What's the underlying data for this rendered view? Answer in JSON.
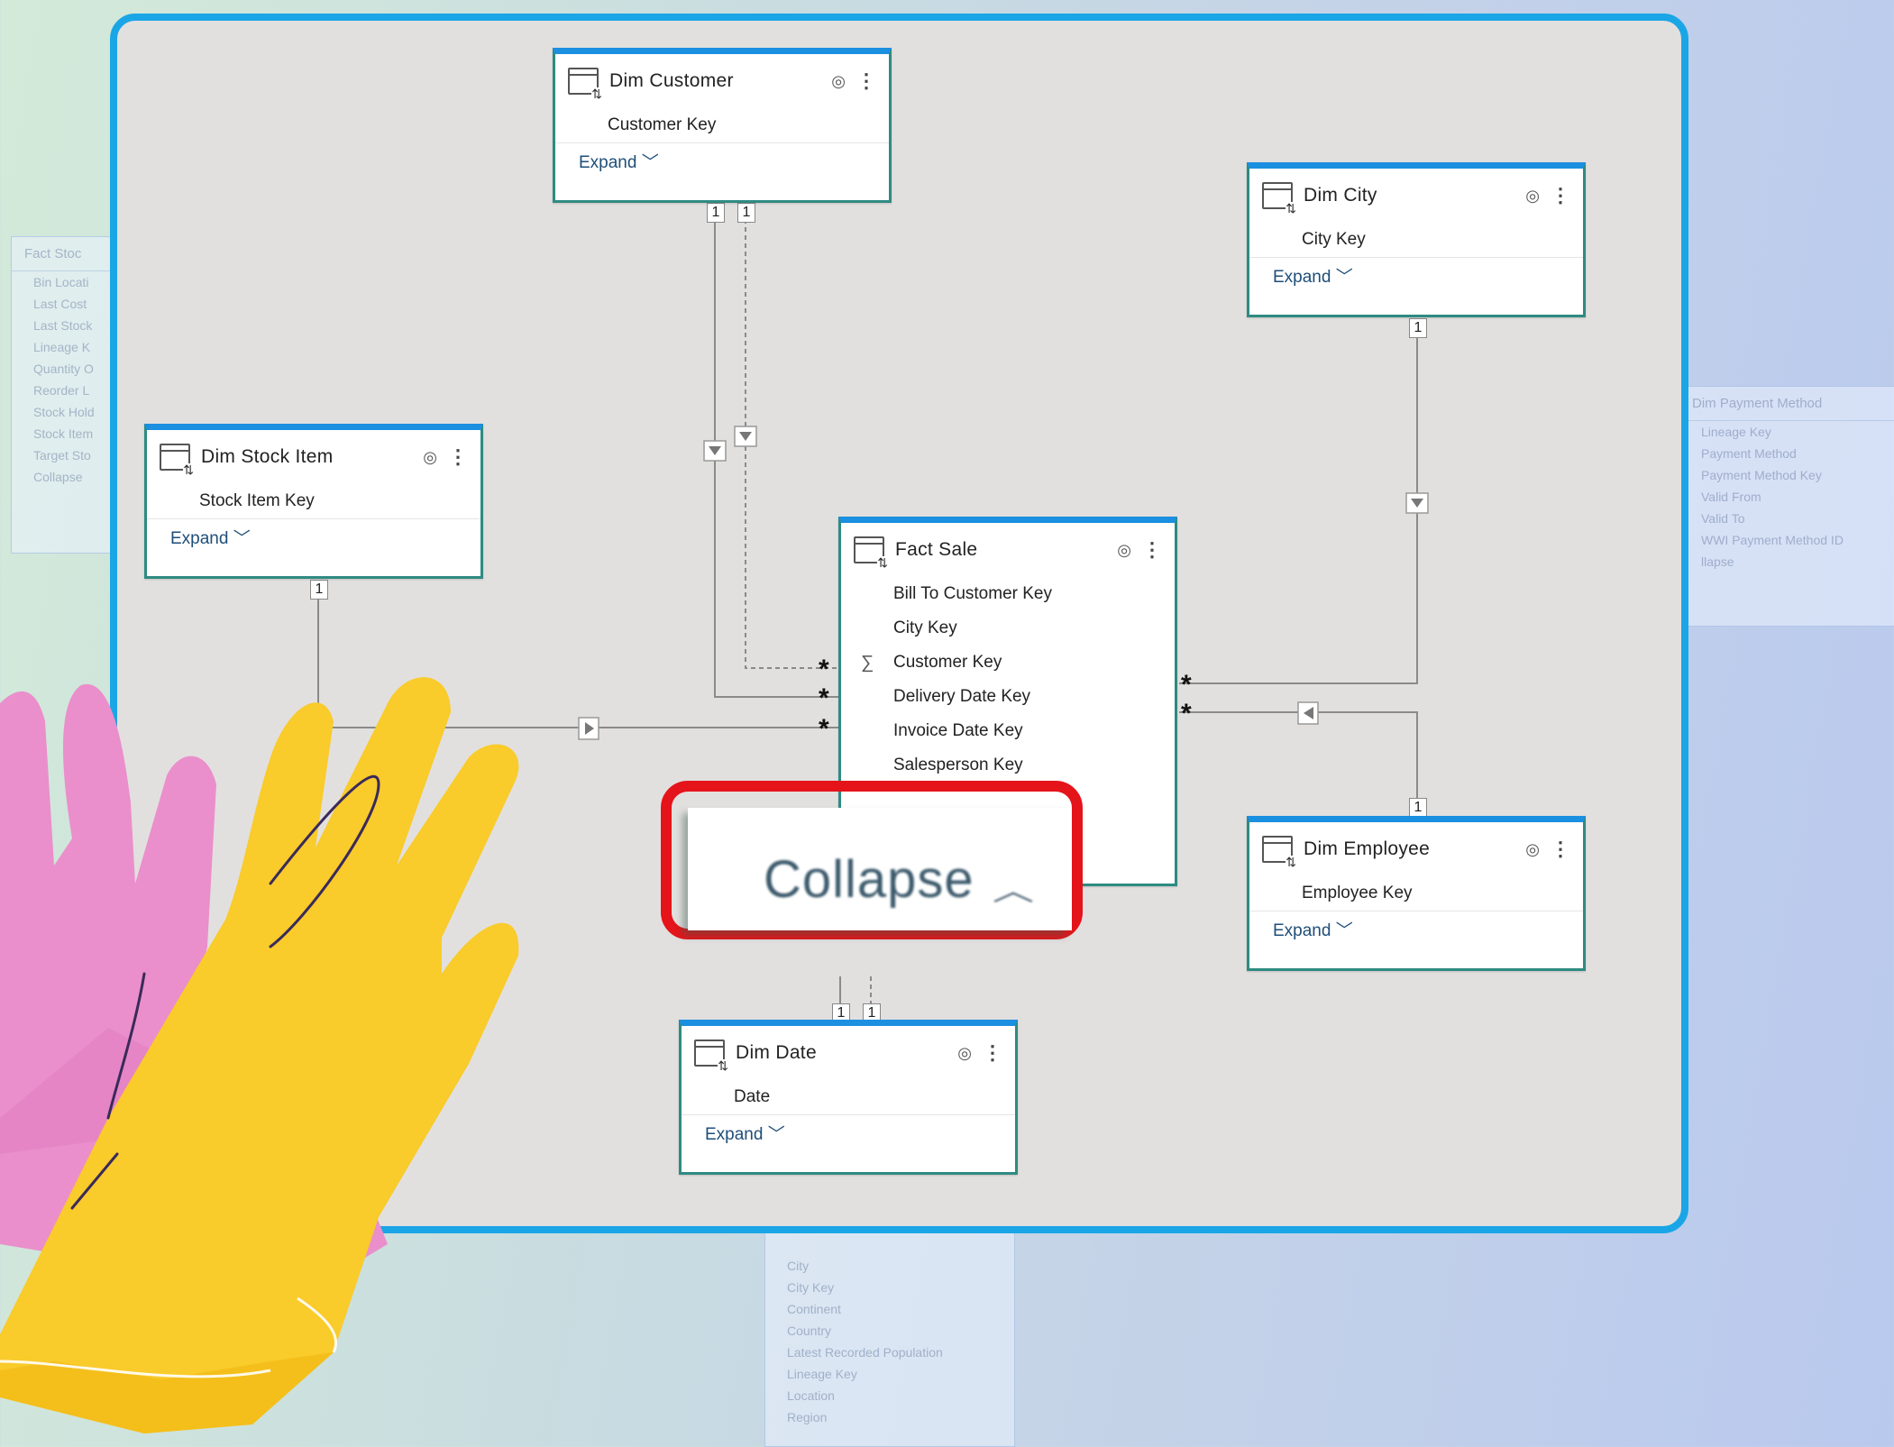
{
  "tables": {
    "dim_customer": {
      "title": "Dim Customer",
      "field": "Customer Key",
      "expand": "Expand"
    },
    "dim_city": {
      "title": "Dim City",
      "field": "City Key",
      "expand": "Expand"
    },
    "dim_stock_item": {
      "title": "Dim Stock Item",
      "field": "Stock Item Key",
      "expand": "Expand"
    },
    "fact_sale": {
      "title": "Fact Sale",
      "fields": [
        "Bill To Customer Key",
        "City Key",
        "Customer Key",
        "Delivery Date Key",
        "Invoice Date Key",
        "Salesperson Key"
      ]
    },
    "dim_employee": {
      "title": "Dim Employee",
      "field": "Employee Key",
      "expand": "Expand"
    },
    "dim_date": {
      "title": "Dim Date",
      "field": "Date",
      "expand": "Expand"
    }
  },
  "collapse": {
    "label": "Collapse"
  },
  "cardinality": {
    "one": "1",
    "many": "*"
  },
  "background_panels": {
    "fact_stock": {
      "title": "Fact Stoc",
      "rows": [
        "Bin Locati",
        "Last Cost",
        "Last Stock",
        "Lineage K",
        "Quantity O",
        "Reorder L",
        "Stock Hold",
        "Stock Item",
        "Target Sto"
      ],
      "collapse": "Collapse"
    },
    "dim_payment_method": {
      "title": "Dim Payment Method",
      "rows": [
        "Lineage Key",
        "Payment Method",
        "Payment Method Key",
        "Valid From",
        "Valid To",
        "WWI Payment Method ID"
      ],
      "collapse": "llapse"
    },
    "dim_city_bottom": {
      "rows": [
        "City",
        "City Key",
        "Continent",
        "Country",
        "Latest Recorded Population",
        "Lineage Key",
        "Location",
        "Region"
      ]
    }
  },
  "colors": {
    "accent": "#1aa6e6",
    "highlight": "#e5141a",
    "table_border": "#2e8b82"
  },
  "icons": [
    "table-icon",
    "eye-icon",
    "more-icon",
    "chevron-down-icon",
    "chevron-up-icon",
    "sum-icon",
    "filter-direction-icon"
  ]
}
